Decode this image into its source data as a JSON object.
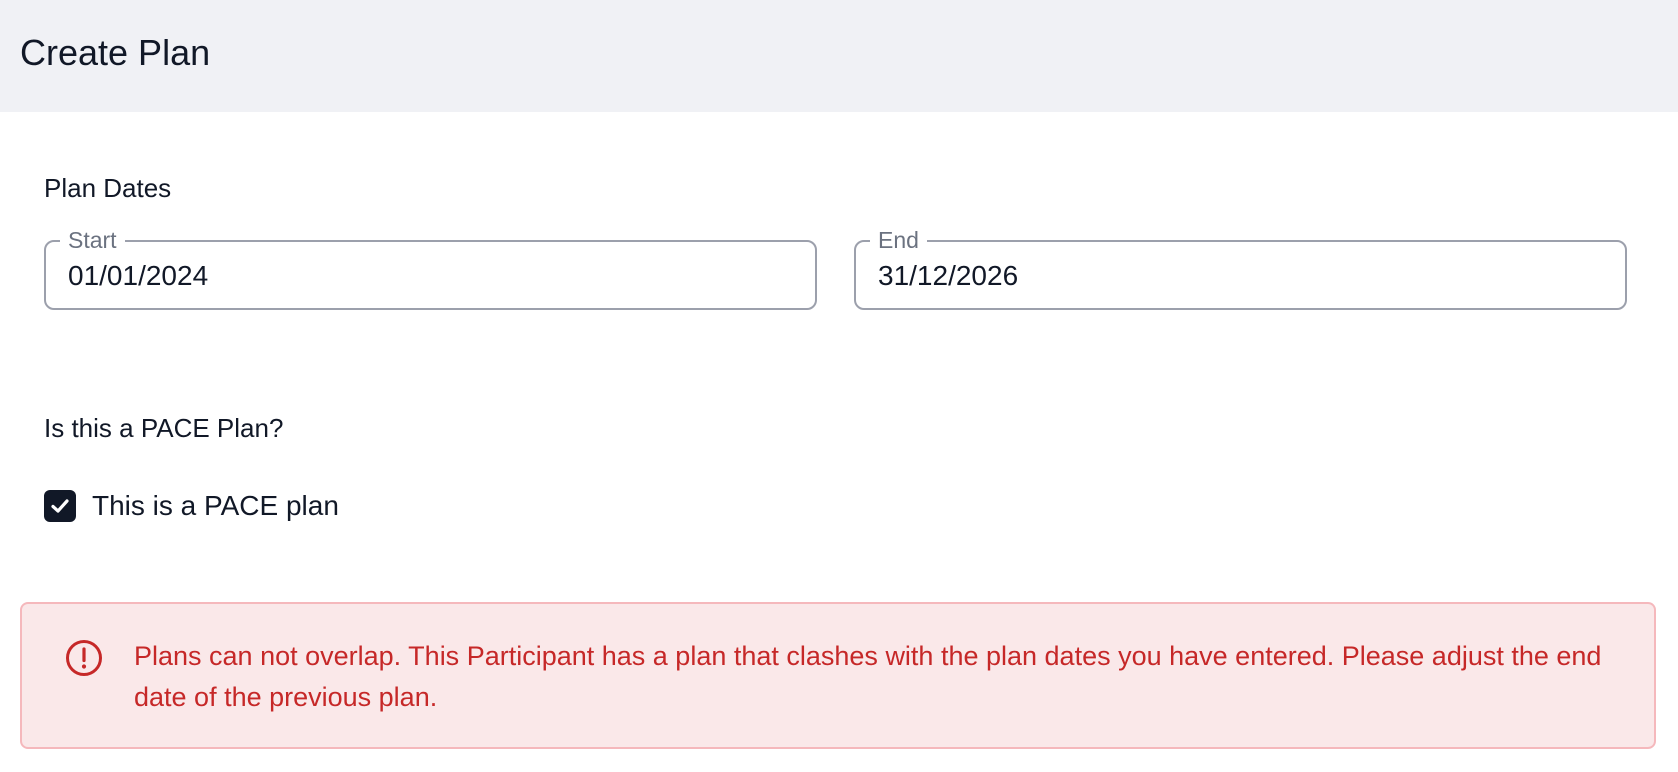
{
  "header": {
    "title": "Create Plan"
  },
  "plan_dates": {
    "title": "Plan Dates",
    "start": {
      "label": "Start",
      "value": "01/01/2024"
    },
    "end": {
      "label": "End",
      "value": "31/12/2026"
    }
  },
  "pace": {
    "question": "Is this a PACE Plan?",
    "checkbox_label": "This is a PACE plan",
    "checked": true
  },
  "alert": {
    "icon": "exclamation-circle-icon",
    "message": "Plans can not overlap. This Participant has a plan that clashes with the plan dates you have entered. Please adjust the end date of the previous plan."
  },
  "colors": {
    "header_bg": "#f0f1f5",
    "text": "#111827",
    "field_border": "#9ca0ac",
    "legend": "#6b7280",
    "checkbox": "#111827",
    "alert_bg": "#fae8e9",
    "alert_border": "#f5b8bc",
    "alert_text": "#c62828"
  }
}
